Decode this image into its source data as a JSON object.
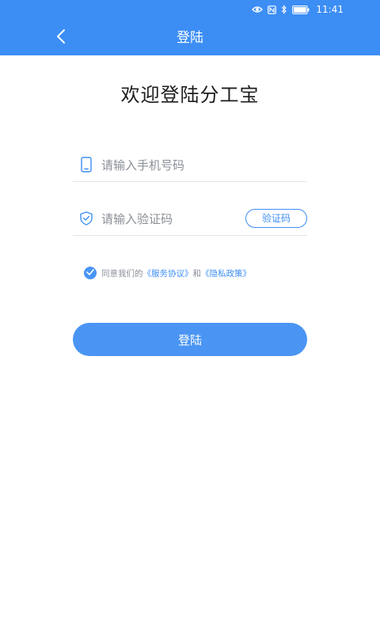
{
  "status_bar": {
    "time": "11:41",
    "icons": [
      "eye-icon",
      "nfc-icon",
      "bluetooth-icon",
      "battery-icon"
    ]
  },
  "header": {
    "title": "登陆",
    "back_icon": "chevron-left-icon"
  },
  "welcome_text": "欢迎登陆分工宝",
  "form": {
    "phone": {
      "placeholder": "请输入手机号码",
      "value": "",
      "icon": "phone-icon"
    },
    "code": {
      "placeholder": "请输入验证码",
      "value": "",
      "icon": "shield-icon",
      "button_label": "验证码"
    }
  },
  "agreement": {
    "checked": true,
    "prefix": "同意我们的",
    "service_link": "《服务协议》",
    "conjunction": "和",
    "privacy_link": "《隐私政策》"
  },
  "login_button": "登陆",
  "colors": {
    "primary": "#3c8ef5",
    "button": "#4a95f3",
    "muted_text": "#8a8f97"
  }
}
